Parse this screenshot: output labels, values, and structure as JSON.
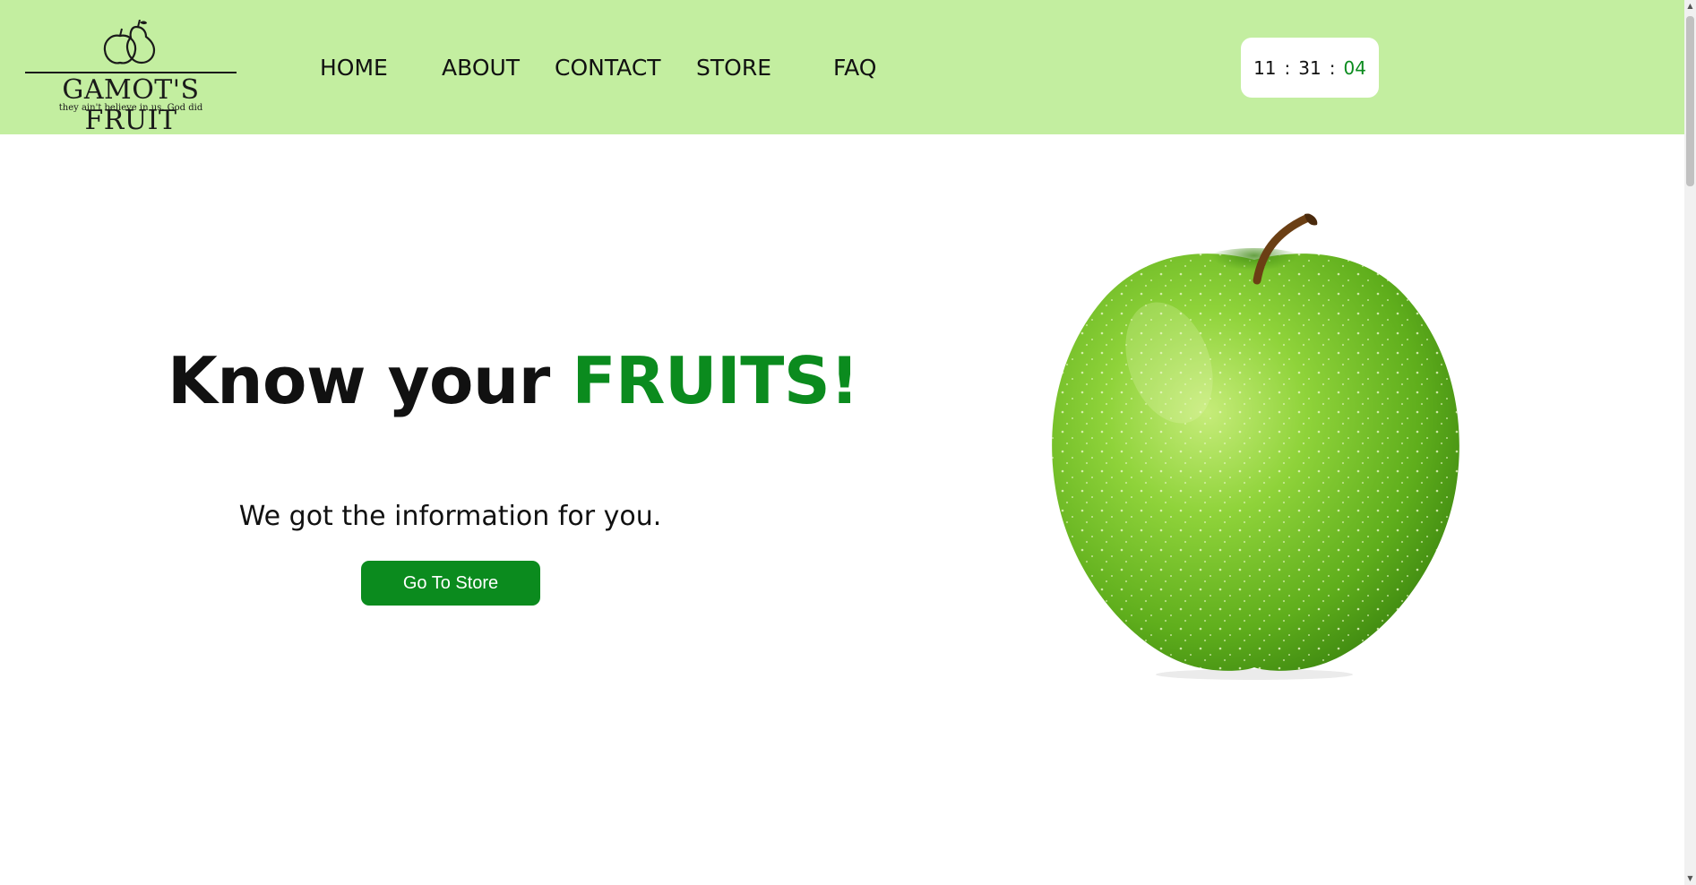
{
  "brand": {
    "name": "GAMOT'S FRUIT",
    "tagline": "they ain't believe in us. God did",
    "logo_icon": "pear-and-apple-outline-icon"
  },
  "nav": {
    "items": [
      {
        "label": "HOME"
      },
      {
        "label": "ABOUT"
      },
      {
        "label": "CONTACT"
      },
      {
        "label": "STORE"
      },
      {
        "label": "FAQ"
      }
    ]
  },
  "clock": {
    "hours": "11",
    "minutes": "31",
    "seconds": "04",
    "separator": ":"
  },
  "hero": {
    "title_prefix": "Know your",
    "title_accent": "FRUITS!",
    "subtitle": "We got the information for you.",
    "button_label": "Go To Store",
    "image_icon": "green-apple-image"
  },
  "colors": {
    "header_bg": "#c3eea0",
    "accent_green": "#0b8b1e",
    "text": "#111111"
  }
}
